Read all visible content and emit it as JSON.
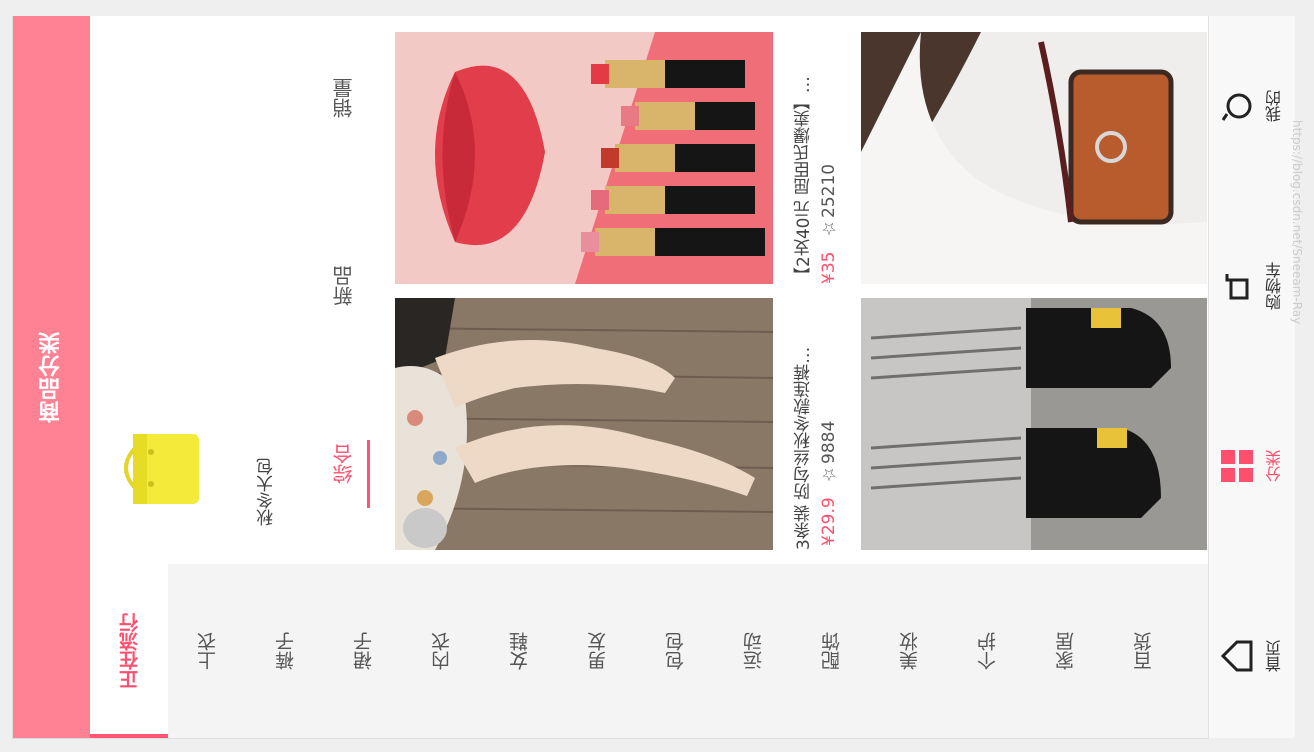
{
  "header": {
    "title": "商品分类"
  },
  "categories": [
    "正在流行",
    "上衣",
    "裤子",
    "裙子",
    "内衣",
    "女鞋",
    "男友",
    "包包",
    "运动",
    "配饰",
    "美妆",
    "个护",
    "家居",
    "百货"
  ],
  "subcategory": {
    "label": "秋冬大包"
  },
  "sort_tabs": {
    "zonghe": "综合",
    "xinpin": "新品",
    "xiaoliang": "销量"
  },
  "products": [
    {
      "title": "3条装 防勾丝秋冬款连裤…",
      "price": "¥29.9",
      "fav": "☆9884"
    },
    {
      "title": "【2支40元 屈臣氏爆卖】…",
      "price": "¥35",
      "fav": "☆25210"
    }
  ],
  "nav": {
    "home": "首页",
    "category": "分类",
    "cart": "购物车",
    "mine": "我的"
  },
  "watermark": "https://blog.csdn.net/Sneeam-Ray",
  "colors": {
    "accent": "#ff4f6e",
    "header": "#ff8194"
  }
}
